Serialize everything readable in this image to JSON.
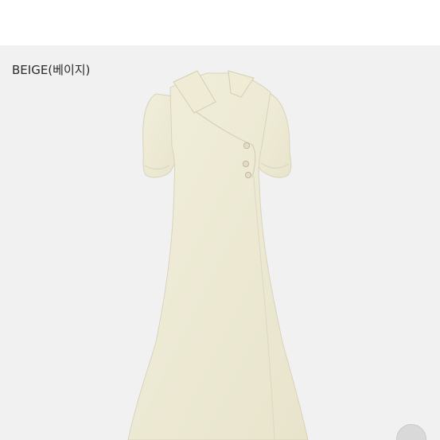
{
  "product": {
    "color_label": "BEIGE(베이지)",
    "color_hex": "#efecd6"
  },
  "page": {
    "background_color": "#f1f1f1",
    "header_color": "#ffffff"
  },
  "controls": {
    "corner_button_icon": "circle-button-icon"
  }
}
